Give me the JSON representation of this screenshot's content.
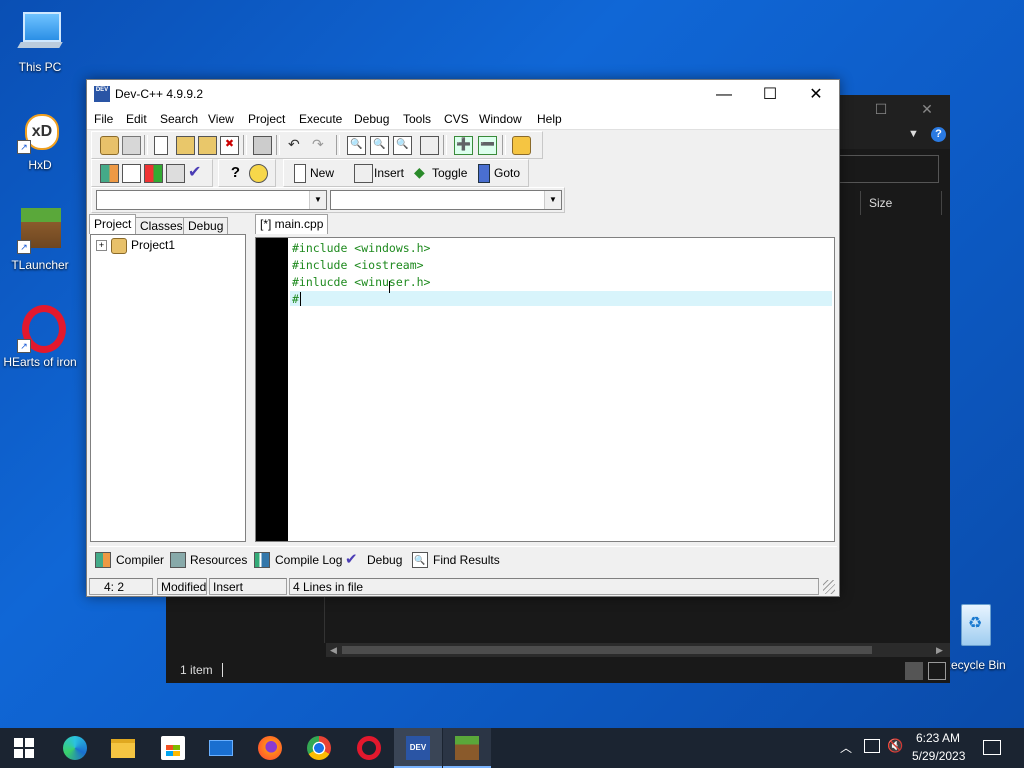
{
  "desktop": {
    "icons": [
      {
        "label": "This PC"
      },
      {
        "label": "HxD"
      },
      {
        "label": "TLauncher"
      },
      {
        "label": "HEarts of iron"
      },
      {
        "label": "Recycle Bin"
      }
    ]
  },
  "explorer": {
    "column_size": "Size",
    "status": "1 item"
  },
  "devcpp": {
    "title": "Dev-C++ 4.9.9.2",
    "menu": [
      "File",
      "Edit",
      "Search",
      "View",
      "Project",
      "Execute",
      "Debug",
      "Tools",
      "CVS",
      "Window",
      "Help"
    ],
    "toolbar2": {
      "new_label": "New",
      "insert_label": "Insert",
      "toggle_label": "Toggle",
      "goto_label": "Goto"
    },
    "left_tabs": [
      "Project",
      "Classes",
      "Debug"
    ],
    "project_tree": {
      "root": "Project1"
    },
    "editor_tab": "[*] main.cpp",
    "code_lines": [
      "#include <windows.h>",
      "#include <iostream>",
      "#inlucde <winuser.h>",
      "#"
    ],
    "bottom_tabs": [
      "Compiler",
      "Resources",
      "Compile Log",
      "Debug",
      "Find Results"
    ],
    "status": {
      "position": "4: 2",
      "state": "Modified",
      "mode": "Insert",
      "lines": "4 Lines in file"
    }
  },
  "taskbar": {
    "time": "6:23 AM",
    "date": "5/29/2023"
  },
  "colors": {
    "desktop": "#0d5cc7",
    "code_text": "#1e8a1e",
    "current_line": "#d8f4fb",
    "taskbar": "#1b2431"
  }
}
